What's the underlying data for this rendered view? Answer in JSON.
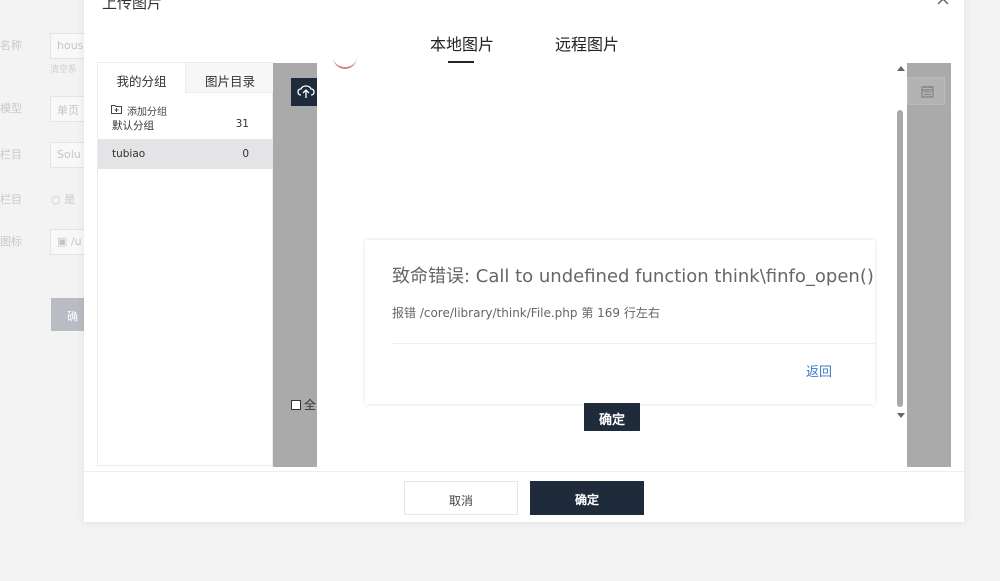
{
  "background": {
    "labels": [
      "名称",
      "模型",
      "栏目",
      "栏目",
      "图标"
    ],
    "inputs": [
      "hous",
      "单页",
      "Solu",
      "/u"
    ],
    "clear_text": "清空系",
    "radio_text": "是",
    "confirm_button": "确"
  },
  "modal": {
    "title": "上传图片",
    "close_icon": "close-icon",
    "tabs": {
      "local": "本地图片",
      "remote": "远程图片"
    }
  },
  "groups": {
    "tab_mine": "我的分组",
    "tab_directory": "图片目录",
    "add_group": "添加分组",
    "items": [
      {
        "name": "默认分组",
        "count": "31"
      },
      {
        "name": "tubiao",
        "count": "0"
      }
    ]
  },
  "image_area": {
    "select_all_label": "全",
    "upload_icon": "cloud-upload-icon",
    "calendar_icon": "calendar-icon"
  },
  "error": {
    "title": "致命错误: Call to undefined function think\\finfo_open()",
    "detail": "报错 /core/library/think/File.php 第 169 行左右",
    "back_link": "返回",
    "confirm": "确定"
  },
  "footer": {
    "cancel": "取消",
    "confirm": "确定"
  },
  "colors": {
    "primary": "#1f2b3b",
    "link": "#3b7bc9",
    "overlay": "#aaaaaa"
  }
}
